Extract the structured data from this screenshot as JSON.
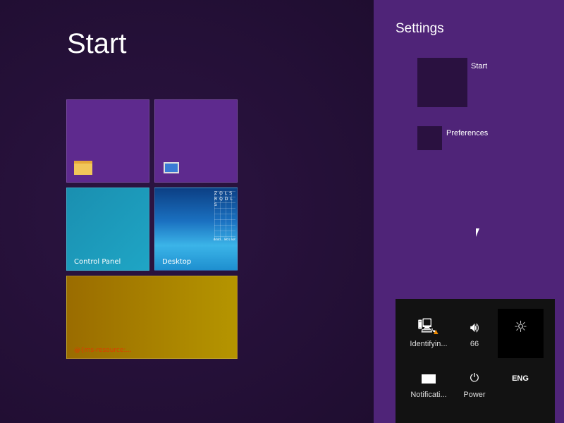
{
  "start": {
    "title": "Start",
    "tiles": [
      {
        "label": "",
        "icon": "file-explorer-icon"
      },
      {
        "label": "",
        "icon": "computer-icon"
      },
      {
        "label": "Control Panel"
      },
      {
        "label": "Desktop",
        "thumb_text": "ZOLSRQDLS",
        "thumb_caption": "dddd... let's not"
      },
      {
        "label": "@{ms-resource:..."
      }
    ]
  },
  "settings": {
    "title": "Settings",
    "items": [
      {
        "label": "Start"
      },
      {
        "label": "Preferences"
      }
    ]
  },
  "tray": {
    "network": "Identifyin...",
    "volume": "66",
    "notifications": "Notificati...",
    "power": "Power",
    "language": "ENG"
  }
}
